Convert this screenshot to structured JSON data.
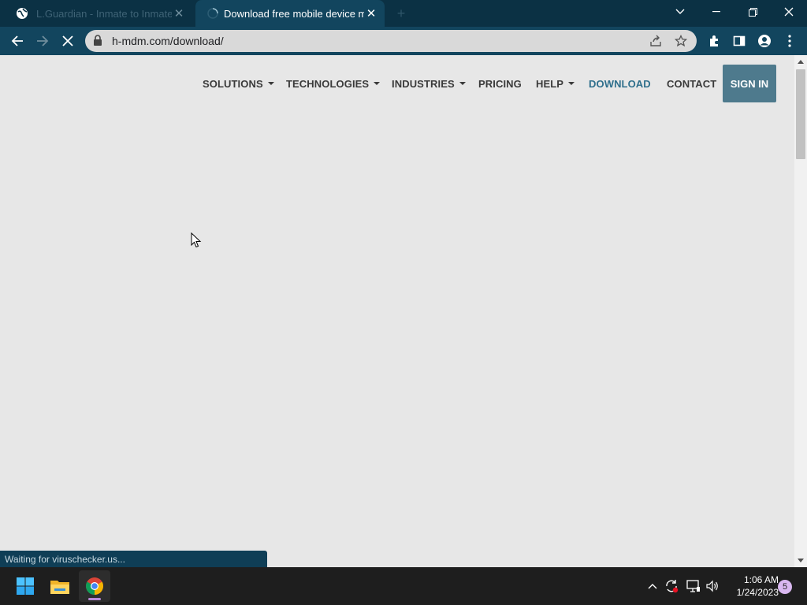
{
  "browser": {
    "tabs": [
      {
        "title": "L.Guardian - Inmate to Inmate",
        "active": false,
        "favicon": "globe-icon"
      },
      {
        "title": "Download free mobile device ma",
        "active": true,
        "favicon": "loading-spinner-icon"
      }
    ],
    "new_tab_label": "+",
    "url": "h-mdm.com/download/",
    "status_text": "Waiting for viruschecker.us..."
  },
  "site": {
    "nav": [
      {
        "label": "SOLUTIONS",
        "dropdown": true
      },
      {
        "label": "TECHNOLOGIES",
        "dropdown": true
      },
      {
        "label": "INDUSTRIES",
        "dropdown": true
      },
      {
        "label": "PRICING",
        "dropdown": false
      },
      {
        "label": "HELP",
        "dropdown": true
      },
      {
        "label": "DOWNLOAD",
        "dropdown": false,
        "active": true
      },
      {
        "label": "CONTACT",
        "dropdown": false
      }
    ],
    "signin_label": "SIGN IN",
    "colors": {
      "background": "#e7e7e7",
      "accent": "#2f6f8c",
      "signin_bg": "#4e7a8d"
    }
  },
  "taskbar": {
    "time": "1:06 AM",
    "date": "1/24/2023",
    "notification_count": "5"
  }
}
